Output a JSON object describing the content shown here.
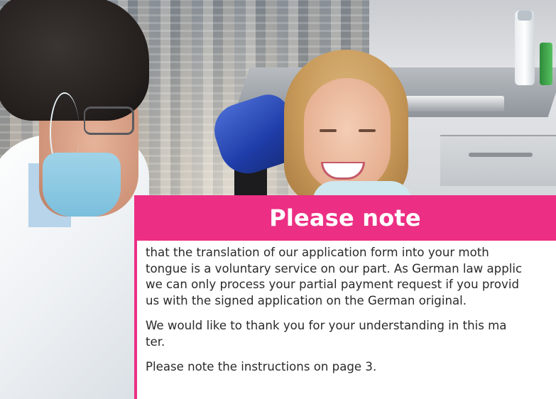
{
  "notice": {
    "title": "Please note",
    "paragraphs": [
      [
        "that the translation of our application form into your moth",
        "tongue is a voluntary service on our part. As German law applic",
        "we can only process your partial payment request if you provid",
        "us with the signed application on the German original."
      ],
      [
        "We would like to thank you for your understanding in this ma",
        "ter."
      ],
      [
        "Please note the instructions on page 3."
      ]
    ]
  },
  "colors": {
    "accent": "#ec2f84",
    "panel_text": "#2a2a2c",
    "chair": "#2743b8"
  }
}
